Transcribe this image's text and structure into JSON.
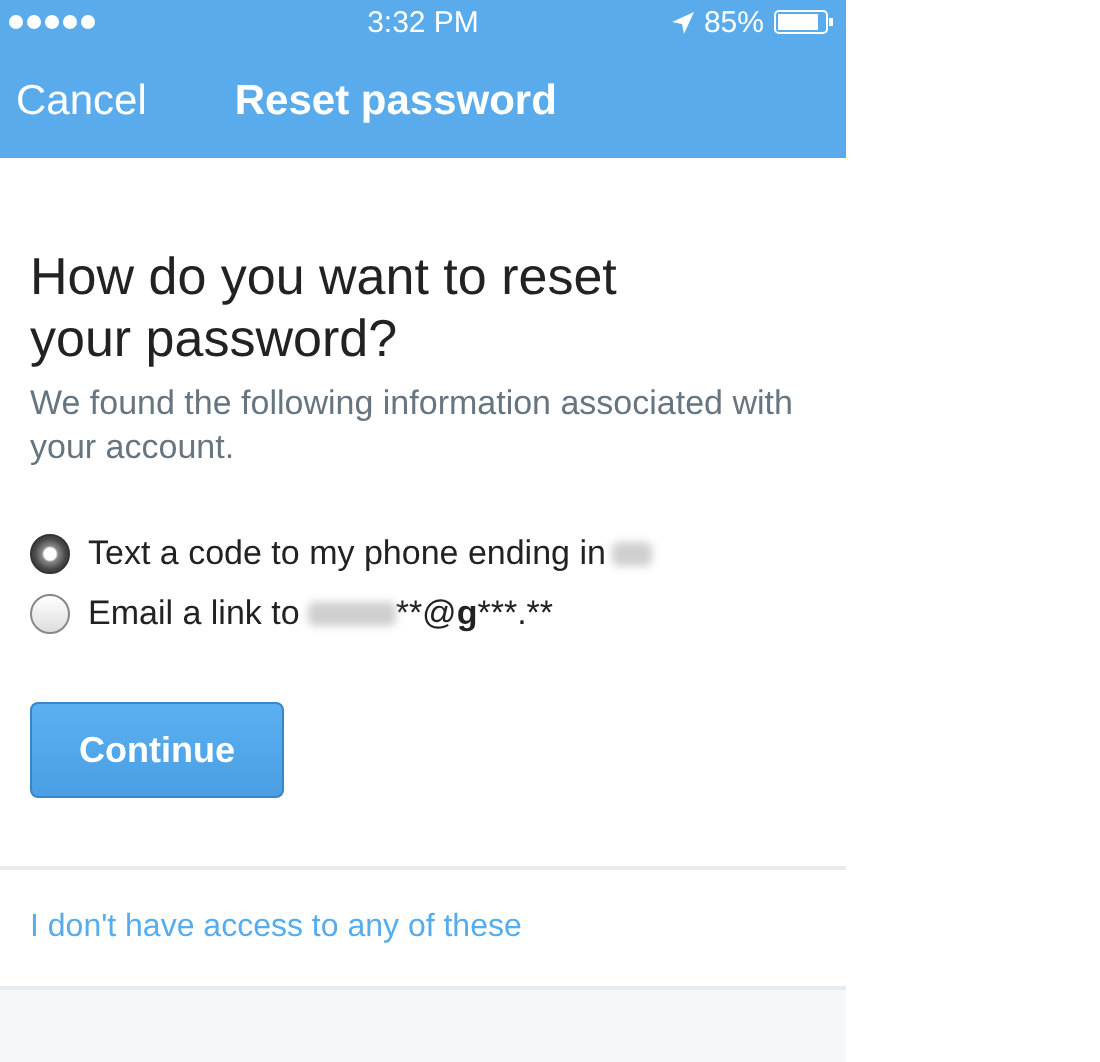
{
  "status_bar": {
    "time": "3:32 PM",
    "battery_percent": "85%"
  },
  "nav_bar": {
    "cancel": "Cancel",
    "title": "Reset password"
  },
  "heading": "How do you want to reset your password?",
  "description": "We found the following information associated with your account.",
  "options": [
    {
      "kind": "phone",
      "label": "Text a code to my phone ending in",
      "selected": true
    },
    {
      "kind": "email",
      "label": "Email a link to",
      "selected": false,
      "email_parts": [
        {
          "text": "**@",
          "bold": false
        },
        {
          "text": "g",
          "bold": true
        },
        {
          "text": "***.**",
          "bold": false
        }
      ]
    }
  ],
  "continue_button": "Continue",
  "no_access_link": "I don't have access to any of these"
}
